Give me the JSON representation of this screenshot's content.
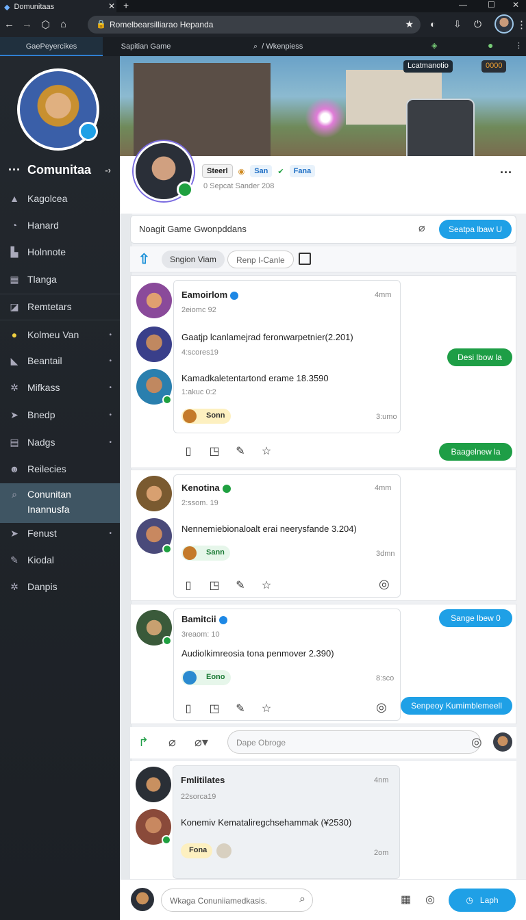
{
  "browser": {
    "tab_title": "Domunitaas",
    "new_tab": "+",
    "url": "Romelbearsilliarao Hepanda",
    "subtabs": [
      "GaePeyercikes",
      "Sapitian Game",
      "Wkenpiess"
    ],
    "banner_pill_left": "Lcatmanotio",
    "banner_pill_right": "0000"
  },
  "sidebar": {
    "title": "Comunitaa",
    "items": [
      {
        "label": "Kagolcea",
        "icon": "triangle-icon"
      },
      {
        "label": "Hanard",
        "icon": "chat-icon"
      },
      {
        "label": "Holnnote",
        "icon": "chart-icon"
      },
      {
        "label": "Tlanga",
        "icon": "grid-icon"
      },
      {
        "label": "Remtetars",
        "icon": "image-icon"
      },
      {
        "label": "Kolmeu Van",
        "icon": "bulb-icon"
      },
      {
        "label": "Beantail",
        "icon": "flag-icon"
      },
      {
        "label": "Mifkass",
        "icon": "gear-icon"
      },
      {
        "label": "Bnedp",
        "icon": "send-icon"
      },
      {
        "label": "Nadgs",
        "icon": "keyboard-icon"
      },
      {
        "label": "Reilecies",
        "icon": "people-icon"
      },
      {
        "label": "Conunitan",
        "label2": "Inannusfa",
        "icon": "search-icon"
      },
      {
        "label": "Fenust",
        "icon": "send-icon"
      },
      {
        "label": "Kiodal",
        "icon": "wrench-icon"
      },
      {
        "label": "Danpis",
        "icon": "gear-icon"
      }
    ]
  },
  "profile": {
    "tag1": "Steerl",
    "tag2": "San",
    "tag3": "Fana",
    "sub": "0 Sepcat Sander 208"
  },
  "composer": {
    "placeholder": "Noagit Game Gwonpddans",
    "button": "Seatpa lbaw U"
  },
  "filters": {
    "selected": "Sngion Viam",
    "other": "Renp I-Canle"
  },
  "posts": [
    {
      "entries": [
        {
          "name": "Eamoirlom",
          "meta": "2eiomc 92",
          "time": "4mm"
        },
        {
          "body": "Gaatjp lcanlamejrad feronwarpetnier(2.201)",
          "meta": "4:scores19"
        },
        {
          "body": "Kamadkaletentartond erame 18.3590",
          "meta": "1:akuc 0:2"
        }
      ],
      "chip": "Sonn",
      "chip_time": "3:umo"
    },
    {
      "entries": [
        {
          "name": "Kenotina",
          "meta": "2:ssom. 19",
          "time": "4mm"
        },
        {
          "body": "Nennemiebionaloalt erai neerysfande 3.204)"
        }
      ],
      "chip": "Sann",
      "chip_time": "3dmn"
    },
    {
      "entries": [
        {
          "name": "Bamitcii",
          "meta": "3reaom: 10"
        },
        {
          "body": "Audiolkimreosia tona penmover 2.390)"
        }
      ],
      "chip": "Eono",
      "chip_time": "8:sco"
    }
  ],
  "bubbles": {
    "b1": "Desi lbow la",
    "b2": "Baagelnew la",
    "b3": "Sange lbew 0",
    "b4": "Senpeoy Kumimblemeell"
  },
  "reply": {
    "placeholder": "Dape Obroge"
  },
  "last_post": {
    "name": "Fmlitilates",
    "meta": "22sorca19",
    "time": "4nm",
    "body": "Konemiv Kemataliregchsehammak (¥2530)",
    "chip": "Fona",
    "chip_time": "2om"
  },
  "bottom": {
    "search_placeholder": "Wkaga Conuniiamedkasis.",
    "button": "Laph"
  },
  "colors": {
    "accent_blue": "#1fa0e6",
    "accent_green": "#1e9e46",
    "sidebar_bg": "#23282e"
  }
}
